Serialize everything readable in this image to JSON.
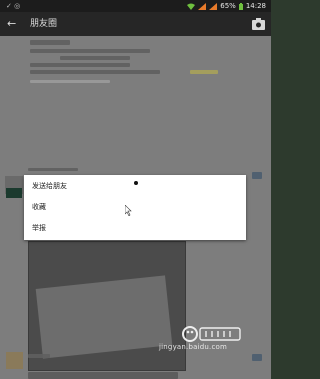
{
  "status_bar": {
    "battery": "65%",
    "time": "14:28"
  },
  "app_bar": {
    "title": "朋友圈",
    "back_icon": "arrow-left-icon",
    "camera_icon": "camera-icon"
  },
  "context_menu": {
    "items": [
      {
        "label": "发送给朋友"
      },
      {
        "label": "收藏"
      },
      {
        "label": "举报"
      }
    ]
  },
  "watermark": {
    "url": "jingyan.baidu.com"
  }
}
